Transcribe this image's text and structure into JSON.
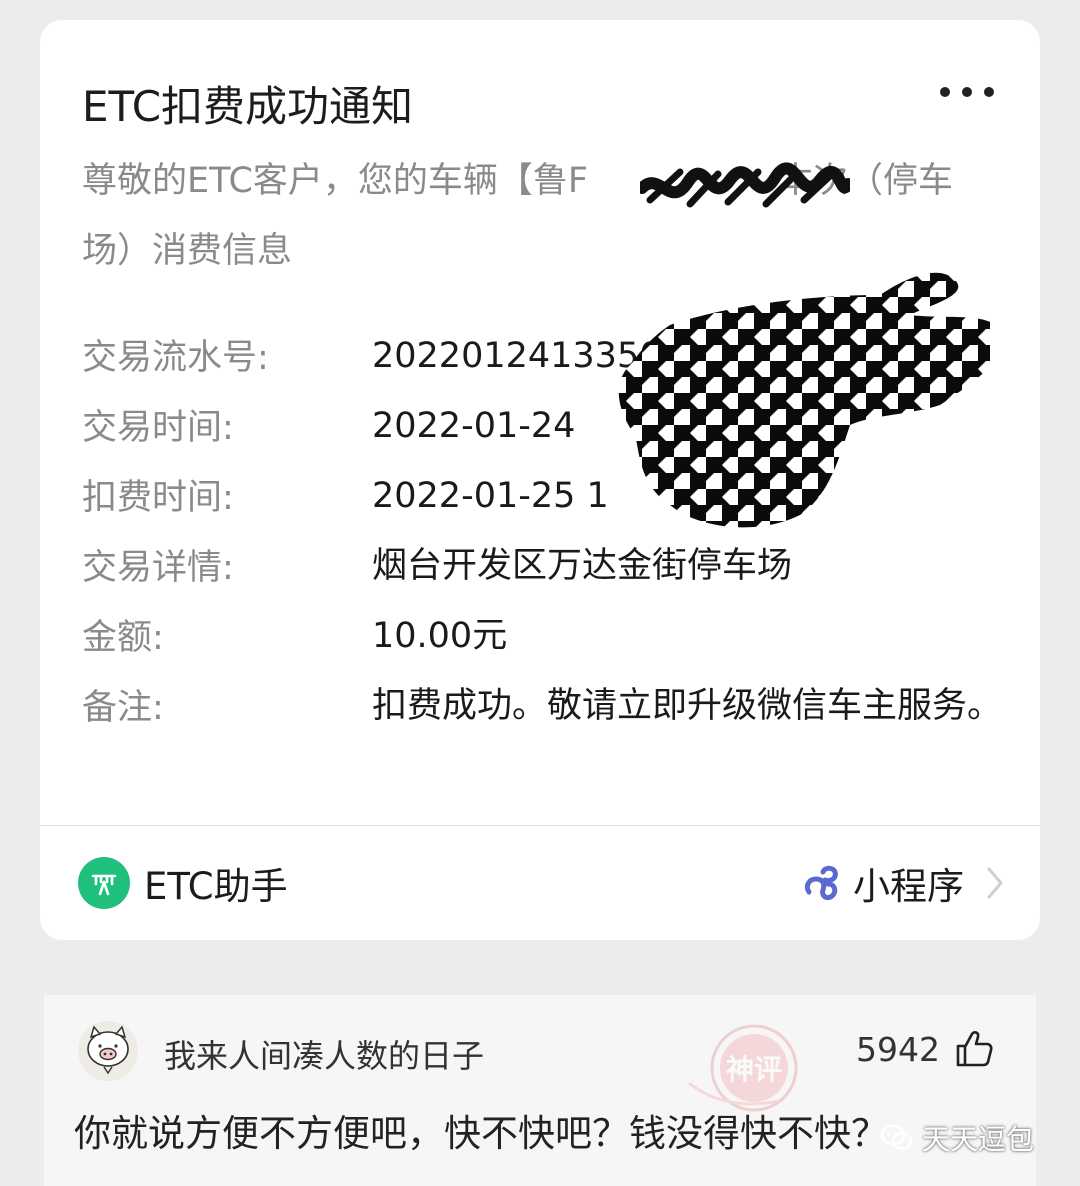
{
  "card": {
    "title": "ETC扣费成功通知",
    "intro": "尊敬的ETC客户，您的车辆【鲁F",
    "intro_tail": "本次（停车场）消费信息",
    "rows": [
      {
        "label": "交易流水号:",
        "value": "2022012413350"
      },
      {
        "label": "交易时间:",
        "value": "2022-01-24"
      },
      {
        "label": "扣费时间:",
        "value": "2022-01-25 1"
      },
      {
        "label": "交易详情:",
        "value": "烟台开发区万达金街停车场"
      },
      {
        "label": "金额:",
        "value": "10.00元"
      },
      {
        "label": "备注:",
        "value": "扣费成功。敬请立即升级微信车主服务。"
      }
    ],
    "footer": {
      "app_name": "ETC助手",
      "mini_program_label": "小程序",
      "icons": {
        "app": "etc-logo-icon",
        "mini_program": "mini-program-icon",
        "chevron": "chevron-right-icon",
        "more": "more-icon"
      }
    },
    "colors": {
      "accent": "#20c07c",
      "mini_program": "#5b6ad0"
    }
  },
  "comment": {
    "username": "我来人间凑人数的日子",
    "likes": "5942",
    "text": "你就说方便不方便吧，快不快吧？钱没得快不快？",
    "stamp": "神评",
    "icons": {
      "avatar": "pig-avatar-icon",
      "like": "thumbs-up-icon"
    }
  },
  "watermark": {
    "text": "天天逗包",
    "icon": "wechat-icon"
  }
}
